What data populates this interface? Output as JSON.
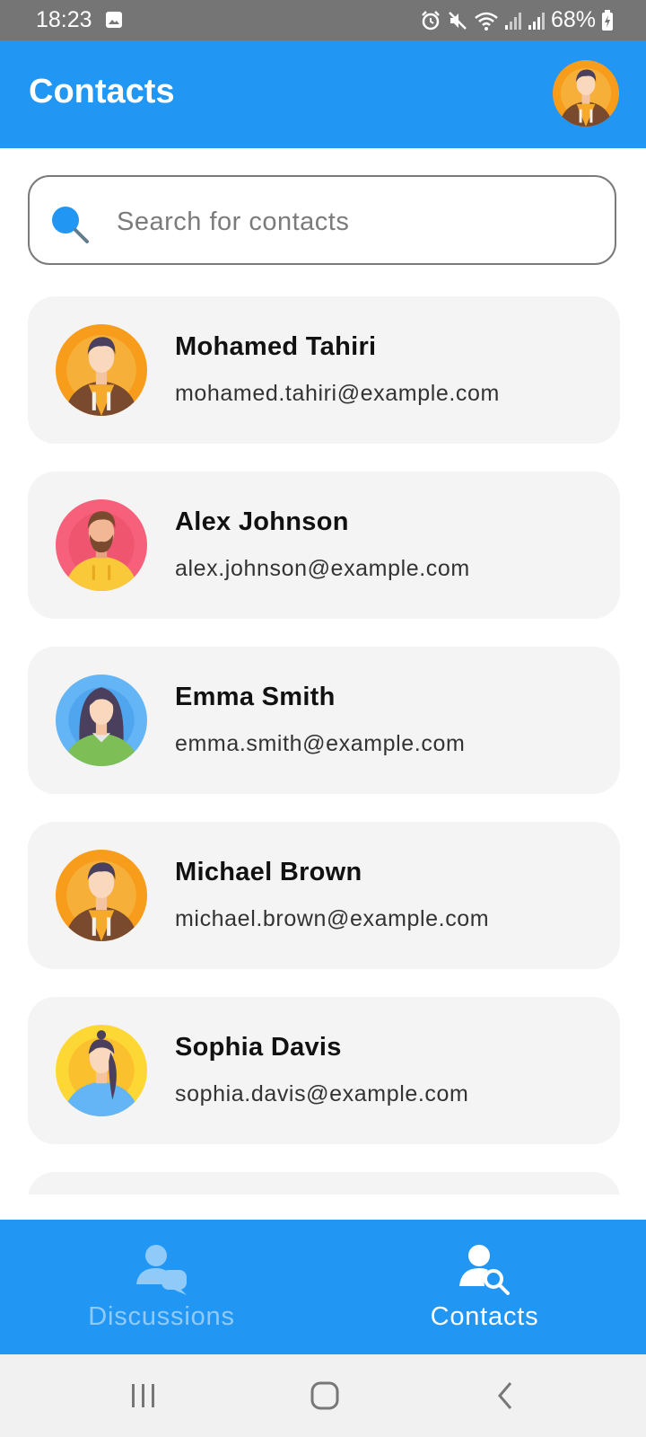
{
  "status_bar": {
    "time": "18:23",
    "battery": "68%",
    "icons": [
      "image-icon",
      "alarm-icon",
      "mute-icon",
      "wifi-icon",
      "signal-icon",
      "signal-icon",
      "battery-charging-icon"
    ]
  },
  "header": {
    "title": "Contacts",
    "profile_icon": "avatar"
  },
  "search": {
    "placeholder": "Search for contacts",
    "value": "",
    "icon": "search-icon"
  },
  "contacts": [
    {
      "name": "Mohamed Tahiri",
      "email": "mohamed.tahiri@example.com",
      "avatar": "man-brown-jacket-avatar"
    },
    {
      "name": "Alex Johnson",
      "email": "alex.johnson@example.com",
      "avatar": "bearded-man-yellow-hoodie-avatar"
    },
    {
      "name": "Emma Smith",
      "email": "emma.smith@example.com",
      "avatar": "woman-green-sweater-avatar"
    },
    {
      "name": "Michael Brown",
      "email": "michael.brown@example.com",
      "avatar": "man-brown-jacket-avatar"
    },
    {
      "name": "Sophia Davis",
      "email": "sophia.davis@example.com",
      "avatar": "woman-ponytail-avatar"
    }
  ],
  "bottom_nav": {
    "items": [
      {
        "label": "Discussions",
        "icon": "discussions-icon",
        "active": false
      },
      {
        "label": "Contacts",
        "icon": "contacts-search-icon",
        "active": true
      }
    ]
  },
  "colors": {
    "primary": "#2196F3",
    "card_background": "#F4F4F4",
    "inactive_nav_label": "#90CAF9",
    "status_bar": "#757575"
  },
  "system_nav": [
    "recents-icon",
    "home-icon",
    "back-icon"
  ]
}
